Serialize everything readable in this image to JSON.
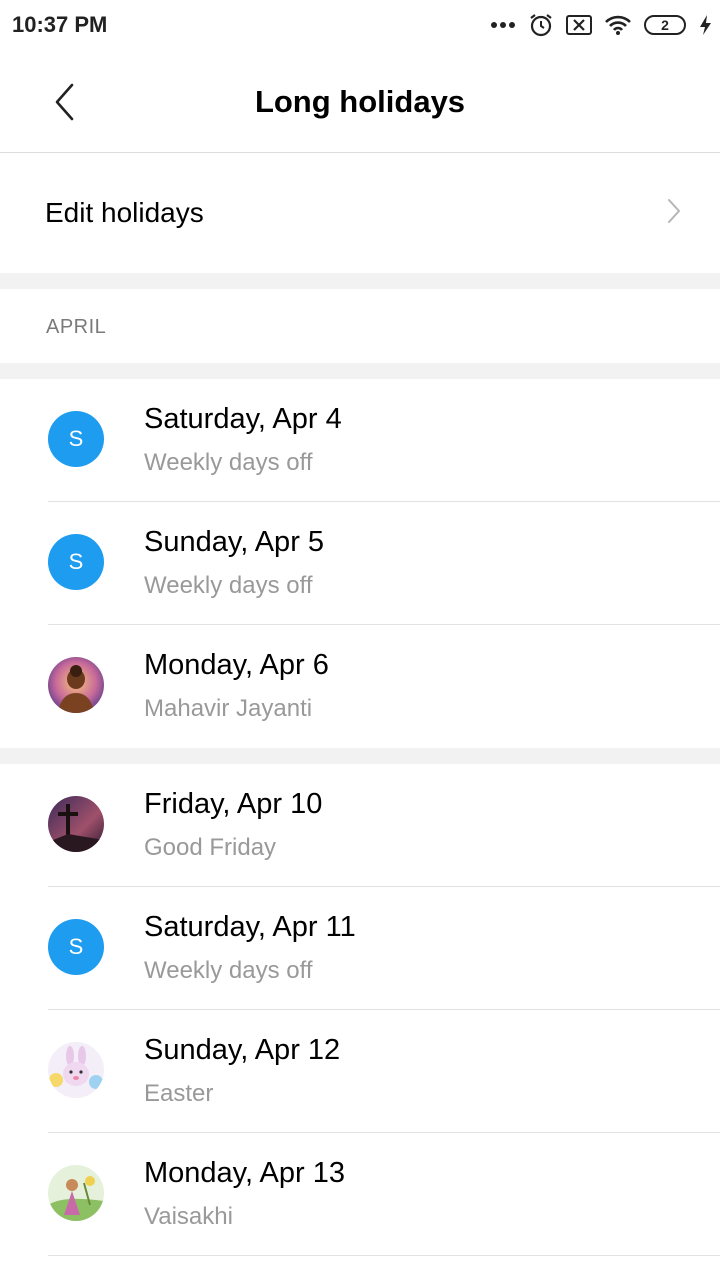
{
  "status_bar": {
    "time": "10:37 PM",
    "battery_level": "2",
    "icons": [
      "more-dots-icon",
      "alarm-icon",
      "sim-off-icon",
      "wifi-icon",
      "battery-icon",
      "charging-icon"
    ]
  },
  "header": {
    "title": "Long holidays",
    "back_icon": "chevron-left-icon"
  },
  "edit_row": {
    "label": "Edit holidays",
    "icon": "chevron-right-icon"
  },
  "section": {
    "month": "APRIL"
  },
  "groups": [
    {
      "items": [
        {
          "date": "Saturday, Apr 4",
          "holiday": "Weekly days off",
          "avatar_type": "letter",
          "avatar_letter": "S"
        },
        {
          "date": "Sunday, Apr 5",
          "holiday": "Weekly days off",
          "avatar_type": "letter",
          "avatar_letter": "S"
        },
        {
          "date": "Monday, Apr 6",
          "holiday": "Mahavir Jayanti",
          "avatar_type": "image",
          "avatar_icon": "mahavir-avatar-icon"
        }
      ]
    },
    {
      "items": [
        {
          "date": "Friday, Apr 10",
          "holiday": "Good Friday",
          "avatar_type": "image",
          "avatar_icon": "cross-avatar-icon"
        },
        {
          "date": "Saturday, Apr 11",
          "holiday": "Weekly days off",
          "avatar_type": "letter",
          "avatar_letter": "S"
        },
        {
          "date": "Sunday, Apr 12",
          "holiday": "Easter",
          "avatar_type": "image",
          "avatar_icon": "easter-bunny-avatar-icon"
        },
        {
          "date": "Monday, Apr 13",
          "holiday": "Vaisakhi",
          "avatar_type": "image",
          "avatar_icon": "vaisakhi-avatar-icon"
        }
      ]
    }
  ],
  "colors": {
    "accent": "#1e9cf0",
    "secondary_text": "#999999",
    "separator": "#f2f2f2"
  }
}
